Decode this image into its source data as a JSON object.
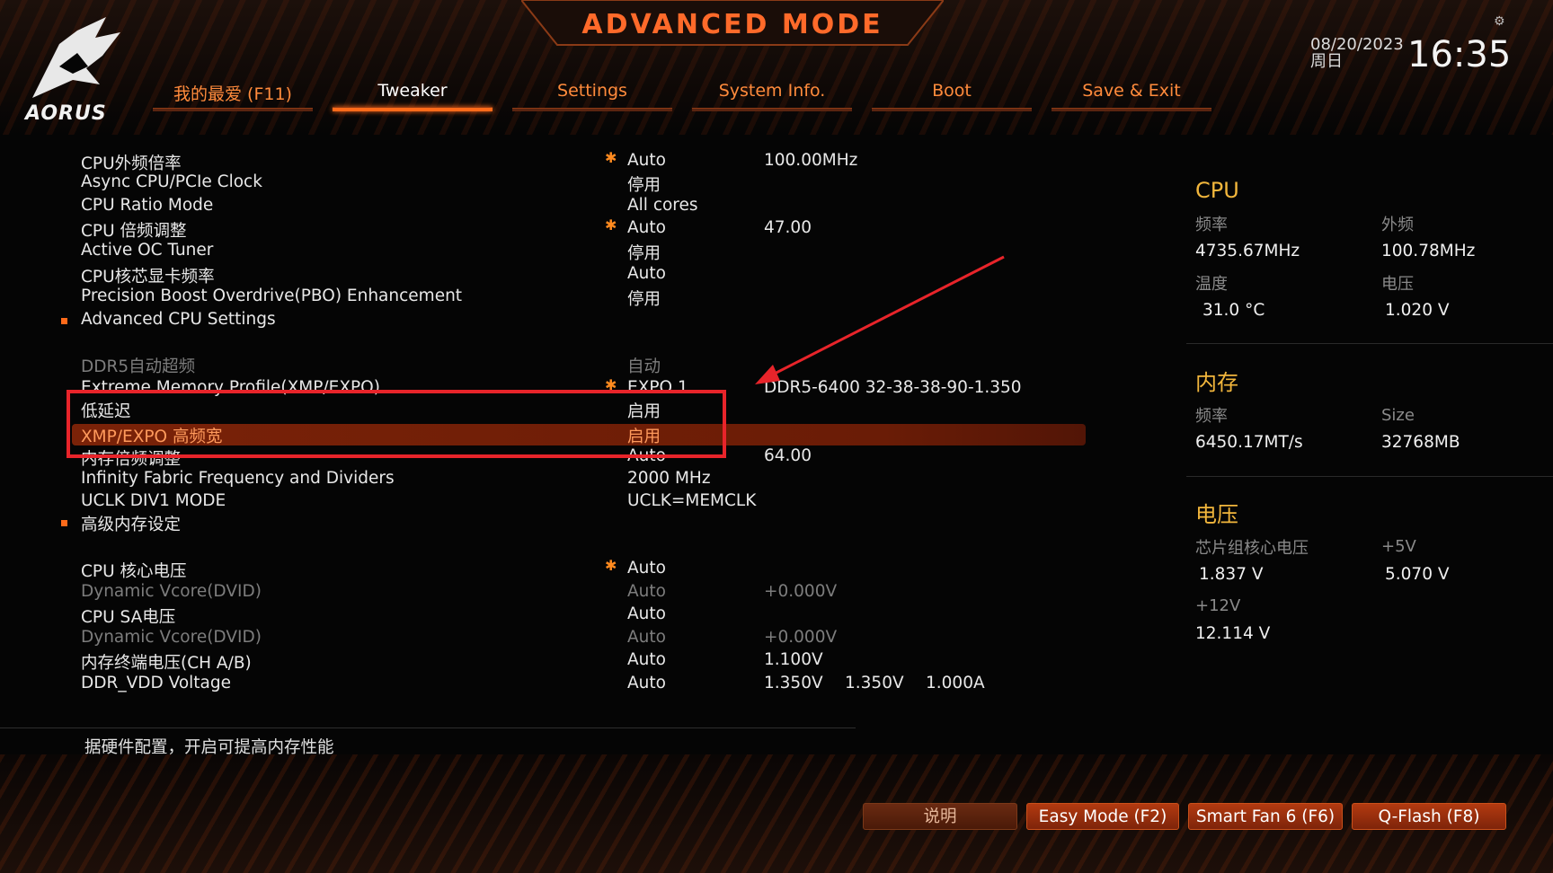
{
  "header": {
    "title": "ADVANCED MODE",
    "logo_text": "AORUS",
    "date": "08/20/2023",
    "weekday": "周日",
    "time": "16:35"
  },
  "tabs": [
    {
      "label": "我的最爱 (F11)",
      "active": false
    },
    {
      "label": "Tweaker",
      "active": true
    },
    {
      "label": "Settings",
      "active": false
    },
    {
      "label": "System Info.",
      "active": false
    },
    {
      "label": "Boot",
      "active": false
    },
    {
      "label": "Save & Exit",
      "active": false
    }
  ],
  "settings": {
    "cpu_base_clock": {
      "label": "CPU外频倍率",
      "value": "Auto",
      "extra": "100.00MHz"
    },
    "async_clock": {
      "label": "Async CPU/PCIe Clock",
      "value": "停用"
    },
    "ratio_mode": {
      "label": "CPU Ratio Mode",
      "value": "All cores"
    },
    "cpu_ratio": {
      "label": "CPU 倍频调整",
      "value": "Auto",
      "extra": "47.00"
    },
    "oc_tuner": {
      "label": "Active OC Tuner",
      "value": "停用"
    },
    "igpu_freq": {
      "label": "CPU核芯显卡频率",
      "value": "Auto"
    },
    "pbo": {
      "label": "Precision Boost Overdrive(PBO) Enhancement",
      "value": "停用"
    },
    "adv_cpu": {
      "label": "Advanced CPU Settings"
    },
    "ddr5_auto": {
      "label": "DDR5自动超频",
      "value": "自动"
    },
    "xmp": {
      "label": "Extreme Memory Profile(XMP/EXPO)",
      "value": "EXPO 1",
      "extra": "DDR5-6400 32-38-38-90-1.350"
    },
    "low_latency": {
      "label": "低延迟",
      "value": "启用"
    },
    "high_bw": {
      "label": "XMP/EXPO 高频宽",
      "value": "启用"
    },
    "mem_ratio": {
      "label": "内存倍频调整",
      "value": "Auto",
      "extra": "64.00"
    },
    "infinity_fabric": {
      "label": "Infinity Fabric Frequency and Dividers",
      "value": "2000 MHz"
    },
    "uclk": {
      "label": "UCLK DIV1 MODE",
      "value": "UCLK=MEMCLK"
    },
    "adv_mem": {
      "label": "高级内存设定"
    },
    "vcore": {
      "label": "CPU 核心电压",
      "value": "Auto"
    },
    "dvid1": {
      "label": "Dynamic Vcore(DVID)",
      "value": "Auto",
      "extra": "+0.000V"
    },
    "sa_voltage": {
      "label": "CPU SA电压",
      "value": "Auto"
    },
    "dvid2": {
      "label": "Dynamic Vcore(DVID)",
      "value": "Auto",
      "extra": "+0.000V"
    },
    "dram_term": {
      "label": "内存终端电压(CH A/B)",
      "value": "Auto",
      "extra": "1.100V"
    },
    "ddr_vdd": {
      "label": "DDR_VDD Voltage",
      "value": "Auto",
      "extra": "1.350V",
      "extra2": "1.350V",
      "extra3": "1.000A"
    }
  },
  "panel": {
    "cpu": {
      "title": "CPU",
      "freq_label": "频率",
      "freq": "4735.67MHz",
      "bclk_label": "外频",
      "bclk": "100.78MHz",
      "temp_label": "温度",
      "temp": "31.0 °C",
      "volt_label": "电压",
      "volt": "1.020 V"
    },
    "memory": {
      "title": "内存",
      "freq_label": "频率",
      "freq": "6450.17MT/s",
      "size_label": "Size",
      "size": "32768MB"
    },
    "voltage": {
      "title": "电压",
      "chipset_label": "芯片组核心电压",
      "chipset": "1.837 V",
      "v5_label": "+5V",
      "v5": "5.070 V",
      "v12_label": "+12V",
      "v12": "12.114 V"
    }
  },
  "help": {
    "text": "据硬件配置，开启可提高内存性能"
  },
  "buttons": {
    "help": "说明",
    "easy_mode": "Easy Mode (F2)",
    "smart_fan": "Smart Fan 6 (F6)",
    "qflash": "Q-Flash (F8)"
  },
  "colors": {
    "accent": "#ff6a1a",
    "highlight_text": "#ff9a5c",
    "panel_title": "#f2b63c",
    "annotation_red": "#e8242a"
  }
}
